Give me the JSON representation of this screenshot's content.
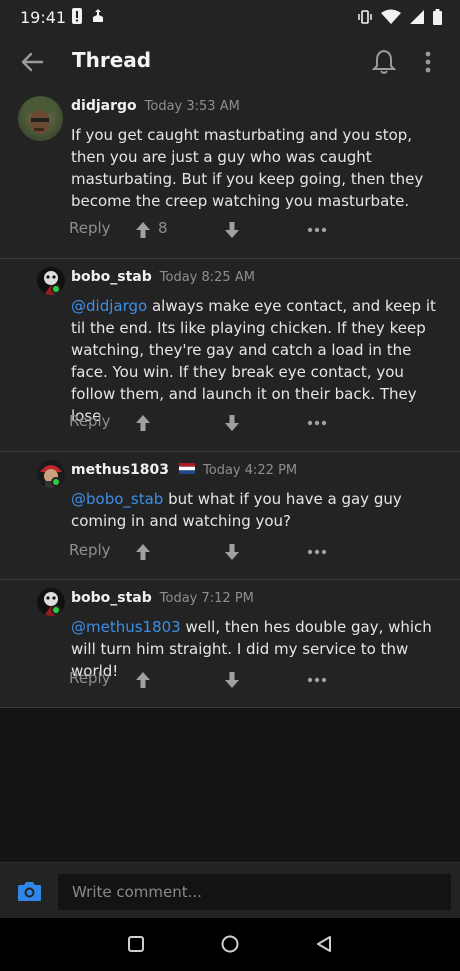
{
  "status_bar": {
    "time": "19:41",
    "left_icons": [
      "alert-icon",
      "app-notification-icon"
    ],
    "right_icons": [
      "vibrate-icon",
      "wifi-icon",
      "signal-icon",
      "battery-icon"
    ]
  },
  "header": {
    "title": "Thread",
    "back_icon": "arrow-left-icon",
    "bell_icon": "bell-icon",
    "more_icon": "more-vert-icon"
  },
  "comments": [
    {
      "username": "didjargo",
      "timestamp": "Today 3:53 AM",
      "mention": "",
      "text": "If you get caught masturbating and you stop, then you are just a guy who was caught masturbating. But if you keep going, then they become the creep watching you masturbate.",
      "reply_label": "Reply",
      "upvotes": "8",
      "online": false,
      "flag": ""
    },
    {
      "username": "bobo_stab",
      "timestamp": "Today 8:25 AM",
      "mention": "@didjargo",
      "text": "always make eye contact, and keep it til the end. Its like playing chicken. If they keep watching, they're gay and catch a load in the face. You win. If they break eye contact, you follow them, and launch it on their back. They lose",
      "reply_label": "Reply",
      "upvotes": "",
      "online": true,
      "flag": ""
    },
    {
      "username": "methus1803",
      "timestamp": "Today 4:22 PM",
      "mention": "@bobo_stab",
      "text": "but what if you have a gay guy coming in and watching you?",
      "reply_label": "Reply",
      "upvotes": "",
      "online": true,
      "flag": "netherlands-flag-icon"
    },
    {
      "username": "bobo_stab",
      "timestamp": "Today 7:12 PM",
      "mention": "@methus1803",
      "text": "well, then hes double gay, which will turn him straight. I did my service to thw world!",
      "reply_label": "Reply",
      "upvotes": "",
      "online": true,
      "flag": ""
    }
  ],
  "composer": {
    "placeholder": "Write comment...",
    "camera_icon": "camera-icon"
  },
  "nav_bar": {
    "buttons": [
      "recents-square-icon",
      "home-circle-icon",
      "back-triangle-icon"
    ]
  },
  "colors": {
    "background": "#141414",
    "card": "#232323",
    "mention": "#3d8fe6",
    "online": "#2ecc40",
    "camera": "#2f86e8"
  }
}
